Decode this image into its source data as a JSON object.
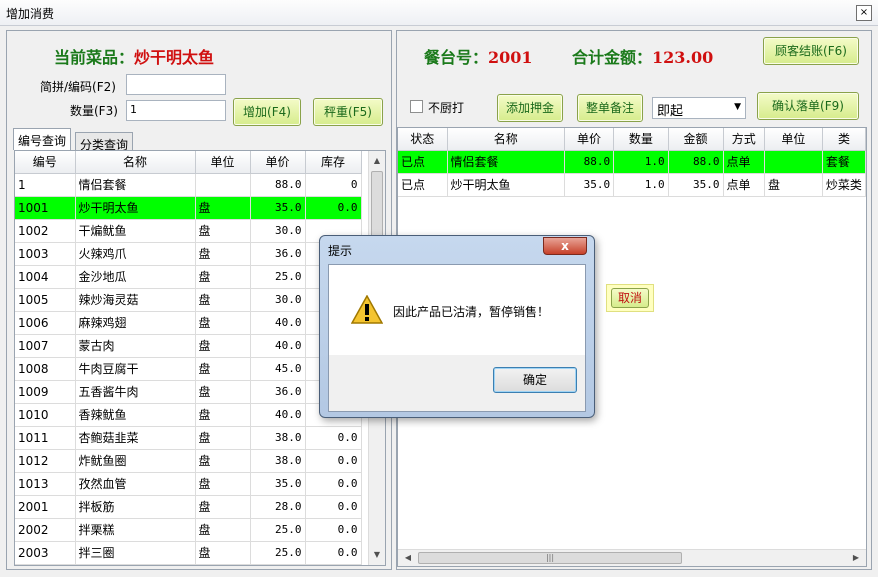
{
  "window": {
    "title": "增加消费",
    "close_glyph": "×"
  },
  "current_dish": {
    "label": "当前菜品：",
    "value": "炒干明太鱼"
  },
  "form": {
    "code_label": "简拼/编码(F2)",
    "code_value": "",
    "qty_label": "数量(F3)",
    "qty_value": "1",
    "add_button": "增加(F4)",
    "weigh_button": "秤重(F5)"
  },
  "tabs": [
    "编号查询",
    "分类查询"
  ],
  "menu_table": {
    "columns": [
      "编号",
      "名称",
      "单位",
      "单价",
      "库存"
    ],
    "rows": [
      [
        "1",
        "情侣套餐",
        "",
        "88.0",
        "0"
      ],
      [
        "1001",
        "炒干明太鱼",
        "盘",
        "35.0",
        "0.0"
      ],
      [
        "1002",
        "干煸鱿鱼",
        "盘",
        "30.0",
        ""
      ],
      [
        "1003",
        "火辣鸡爪",
        "盘",
        "36.0",
        ""
      ],
      [
        "1004",
        "金沙地瓜",
        "盘",
        "25.0",
        ""
      ],
      [
        "1005",
        "辣炒海灵菇",
        "盘",
        "30.0",
        ""
      ],
      [
        "1006",
        "麻辣鸡翅",
        "盘",
        "40.0",
        ""
      ],
      [
        "1007",
        "蒙古肉",
        "盘",
        "40.0",
        ""
      ],
      [
        "1008",
        "牛肉豆腐干",
        "盘",
        "45.0",
        ""
      ],
      [
        "1009",
        "五香酱牛肉",
        "盘",
        "36.0",
        ""
      ],
      [
        "1010",
        "香辣鱿鱼",
        "盘",
        "40.0",
        ""
      ],
      [
        "1011",
        "杏鲍菇韭菜",
        "盘",
        "38.0",
        "0.0"
      ],
      [
        "1012",
        "炸鱿鱼圈",
        "盘",
        "38.0",
        "0.0"
      ],
      [
        "1013",
        "孜然血管",
        "盘",
        "35.0",
        "0.0"
      ],
      [
        "2001",
        "拌板筋",
        "盘",
        "28.0",
        "0.0"
      ],
      [
        "2002",
        "拌栗糕",
        "盘",
        "25.0",
        "0.0"
      ],
      [
        "2003",
        "拌三圈",
        "盘",
        "25.0",
        "0.0"
      ]
    ],
    "selected_index": 1
  },
  "header": {
    "table_label": "餐台号：",
    "table_value": "2001",
    "total_label": "合计金额：",
    "total_value": "123.00",
    "checkout_button": "顾客结账(F6)"
  },
  "options": {
    "no_print_label": "不厨打",
    "deposit_button": "添加押金",
    "remark_button": "整单备注",
    "timing_select": "即起",
    "confirm_button": "确认落单(F9)"
  },
  "order_table": {
    "columns": [
      "状态",
      "名称",
      "单价",
      "数量",
      "金额",
      "方式",
      "单位",
      "类"
    ],
    "rows": [
      [
        "已点",
        "情侣套餐",
        "88.0",
        "1.0",
        "88.0",
        "点单",
        "",
        "套餐"
      ],
      [
        "已点",
        "炒干明太鱼",
        "35.0",
        "1.0",
        "35.0",
        "点单",
        "盘",
        "炒菜类"
      ]
    ],
    "selected_index": 0
  },
  "cancel_button": "取消",
  "dialog": {
    "title": "提示",
    "close_glyph": "x",
    "message": "因此产品已沽清，暂停销售！",
    "ok_button": "确定",
    "icon": "warning-icon"
  },
  "colors": {
    "selected_row": "#00ff00",
    "label_green": "#1b7a1b",
    "value_red": "#d01010"
  }
}
